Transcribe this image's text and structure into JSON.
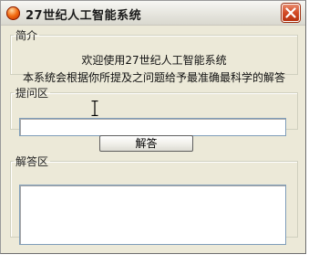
{
  "window": {
    "title": "27世纪人工智能系统",
    "accent": "#e45a18",
    "close_icon": "close-icon"
  },
  "intro": {
    "legend": "简介",
    "line1": "欢迎使用27世纪人工智能系统",
    "line2": "本系统会根据你所提及之问题给予最准确最科学的解答"
  },
  "ask": {
    "legend": "提问区",
    "value": ""
  },
  "answer_button": {
    "label": "解答"
  },
  "answer": {
    "legend": "解答区",
    "value": ""
  }
}
